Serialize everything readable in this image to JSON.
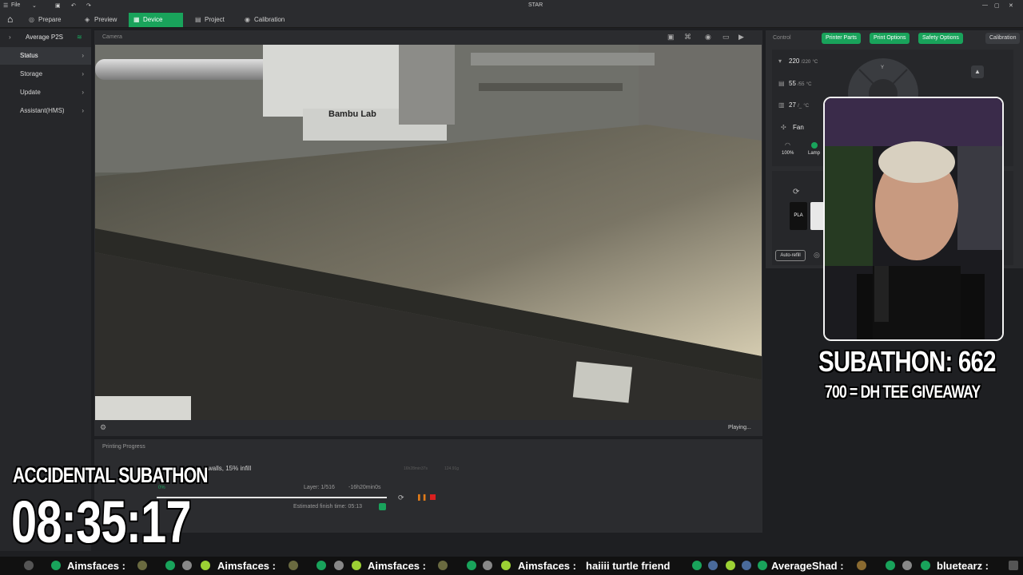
{
  "titlebar": {
    "menu_label": "File",
    "title": "STAR"
  },
  "tabs": [
    {
      "label": "Prepare"
    },
    {
      "label": "Preview"
    },
    {
      "label": "Device"
    },
    {
      "label": "Project"
    },
    {
      "label": "Calibration"
    }
  ],
  "sidebar": {
    "printer_name": "Average P2S",
    "items": [
      {
        "label": "Status"
      },
      {
        "label": "Storage"
      },
      {
        "label": "Update"
      },
      {
        "label": "Assistant(HMS)"
      }
    ]
  },
  "camera": {
    "header": "Camera",
    "status": "Playing...",
    "brand_text": "Bambu Lab"
  },
  "progress": {
    "header": "Printing Progress",
    "description": "walls, 15% infill",
    "time_dim": "16h28min37s",
    "weight_dim": "124.91g",
    "layer": "Layer: 1/516",
    "remaining": "-16h20min0s",
    "percent": "0%",
    "percent_value": 0.0,
    "finish_time": "Estimated finish time: 05:13"
  },
  "control": {
    "header": "Control",
    "buttons": [
      {
        "label": "Printer Parts"
      },
      {
        "label": "Print Options"
      },
      {
        "label": "Safety Options"
      },
      {
        "label": "Calibration"
      }
    ],
    "nozzle_temp": "220",
    "nozzle_target": "/220",
    "bed_temp": "55",
    "bed_target": "/55",
    "chamber_temp": "27",
    "chamber_target": "/_",
    "unit": "°C",
    "fan_label": "Fan",
    "fan_speed": "100%",
    "lamp_label": "Lamp",
    "filament_label": "PLA",
    "auto_refill_label": "Auto-refill",
    "y_axis_label": "Y"
  },
  "overlays": {
    "subathon_count": "SUBATHON: 662",
    "giveaway": "700 = DH TEE GIVEAWAY",
    "timer_title": "ACCIDENTAL SUBATHON",
    "timer": "08:35:17"
  },
  "ticker": {
    "items": [
      "Aimsfaces :",
      "Aimsfaces :",
      "Aimsfaces :",
      "Aimsfaces :",
      "haiiii turtle friend",
      "AverageShad :",
      "bluetearz :"
    ]
  },
  "colors": {
    "accent": "#19a35b",
    "panel": "#2b2c2f",
    "background": "#1e1f22"
  }
}
